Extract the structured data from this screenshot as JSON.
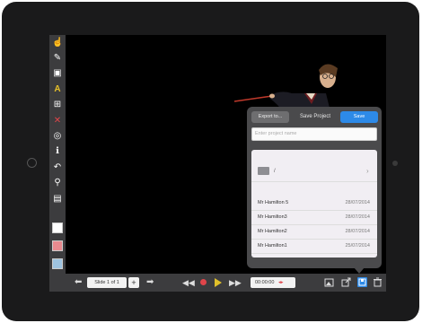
{
  "toolbar": {
    "tools": [
      {
        "name": "pointer-tool-icon",
        "glyph": "☝"
      },
      {
        "name": "pen-tool-icon",
        "glyph": "✎"
      },
      {
        "name": "image-tool-icon",
        "glyph": "▣"
      },
      {
        "name": "text-tool-icon",
        "glyph": "A"
      },
      {
        "name": "add-box-tool-icon",
        "glyph": "⊞"
      },
      {
        "name": "delete-tool-icon",
        "glyph": "✕"
      },
      {
        "name": "target-tool-icon",
        "glyph": "◎"
      },
      {
        "name": "info-tool-icon",
        "glyph": "ℹ"
      },
      {
        "name": "undo-tool-icon",
        "glyph": "↶"
      },
      {
        "name": "zoom-tool-icon",
        "glyph": "⚲"
      },
      {
        "name": "background-tool-icon",
        "glyph": "▤"
      }
    ],
    "colors": [
      "#ffffff",
      "#e88a8f",
      "#9ec3e0"
    ]
  },
  "bottombar": {
    "slide_label": "Slide 1 of 1",
    "add_label": "+",
    "time_label": "00:00:00"
  },
  "popover": {
    "export_label": "Export to...",
    "title": "Save Project",
    "save_label": "Save",
    "name_placeholder": "Enter project name",
    "folder_label": "/",
    "files": [
      {
        "name": "Mr Hamilton 5",
        "date": "28/07/2014"
      },
      {
        "name": "Mr Hamilton3",
        "date": "28/07/2014"
      },
      {
        "name": "Mr Hamilton2",
        "date": "28/07/2014"
      },
      {
        "name": "Mr Hamilton1",
        "date": "25/07/2014"
      }
    ]
  },
  "colors": {
    "accent": "#2d8ae8",
    "record": "#e0454a",
    "play": "#e0c02a"
  }
}
